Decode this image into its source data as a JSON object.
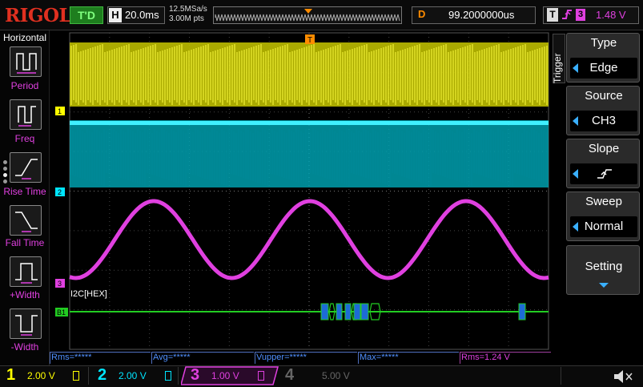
{
  "header": {
    "logo": "RIGOL",
    "run_status": "T'D",
    "horizontal": {
      "key": "H",
      "value": "20.0ms"
    },
    "sample_rate": "12.5MSa/s",
    "memory_depth": "3.00M pts",
    "delay": {
      "key": "D",
      "value": "99.2000000us"
    },
    "trigger": {
      "key": "T",
      "source_badge": "3",
      "level": "1.48 V"
    }
  },
  "left_menu": {
    "title": "Horizontal",
    "items": [
      {
        "label": "Period",
        "icon": "period-icon"
      },
      {
        "label": "Freq",
        "icon": "frequency-icon"
      },
      {
        "label": "Rise Time",
        "icon": "rise-time-icon"
      },
      {
        "label": "Fall Time",
        "icon": "fall-time-icon"
      },
      {
        "label": "+Width",
        "icon": "positive-width-icon"
      },
      {
        "label": "-Width",
        "icon": "negative-width-icon"
      }
    ]
  },
  "right_menu": {
    "tab_label": "Trigger",
    "items": [
      {
        "title": "Type",
        "value": "Edge"
      },
      {
        "title": "Source",
        "value": "CH3"
      },
      {
        "title": "Slope",
        "value": "",
        "icon": "rising-edge-icon"
      },
      {
        "title": "Sweep",
        "value": "Normal"
      },
      {
        "title": "Setting",
        "value": ""
      }
    ]
  },
  "display": {
    "channel_markers": [
      "1",
      "2",
      "3"
    ],
    "bus_marker": "B1",
    "decode_label": "I2C[HEX]",
    "trigger_position_marker": "T",
    "trigger_level_marker": "T"
  },
  "measurements": [
    {
      "label": "Rms=*****"
    },
    {
      "label": "Avg=*****"
    },
    {
      "label": "Vupper=*****"
    },
    {
      "label": "Max=*****"
    },
    {
      "label": "Rms=1.24 V"
    }
  ],
  "channels": [
    {
      "number": "1",
      "scale": "2.00 V",
      "color": "#ffff00",
      "active": true
    },
    {
      "number": "2",
      "scale": "2.00 V",
      "color": "#00e5ff",
      "active": true
    },
    {
      "number": "3",
      "scale": "1.00 V",
      "color": "#e040e0",
      "active": true
    },
    {
      "number": "4",
      "scale": "5.00 V",
      "color": "#666666",
      "active": false
    }
  ],
  "colors": {
    "ch1": "#ffff00",
    "ch2": "#00e5ff",
    "ch3": "#e040e0",
    "decode": "#22cc22",
    "trigger": "#ff8c00"
  }
}
